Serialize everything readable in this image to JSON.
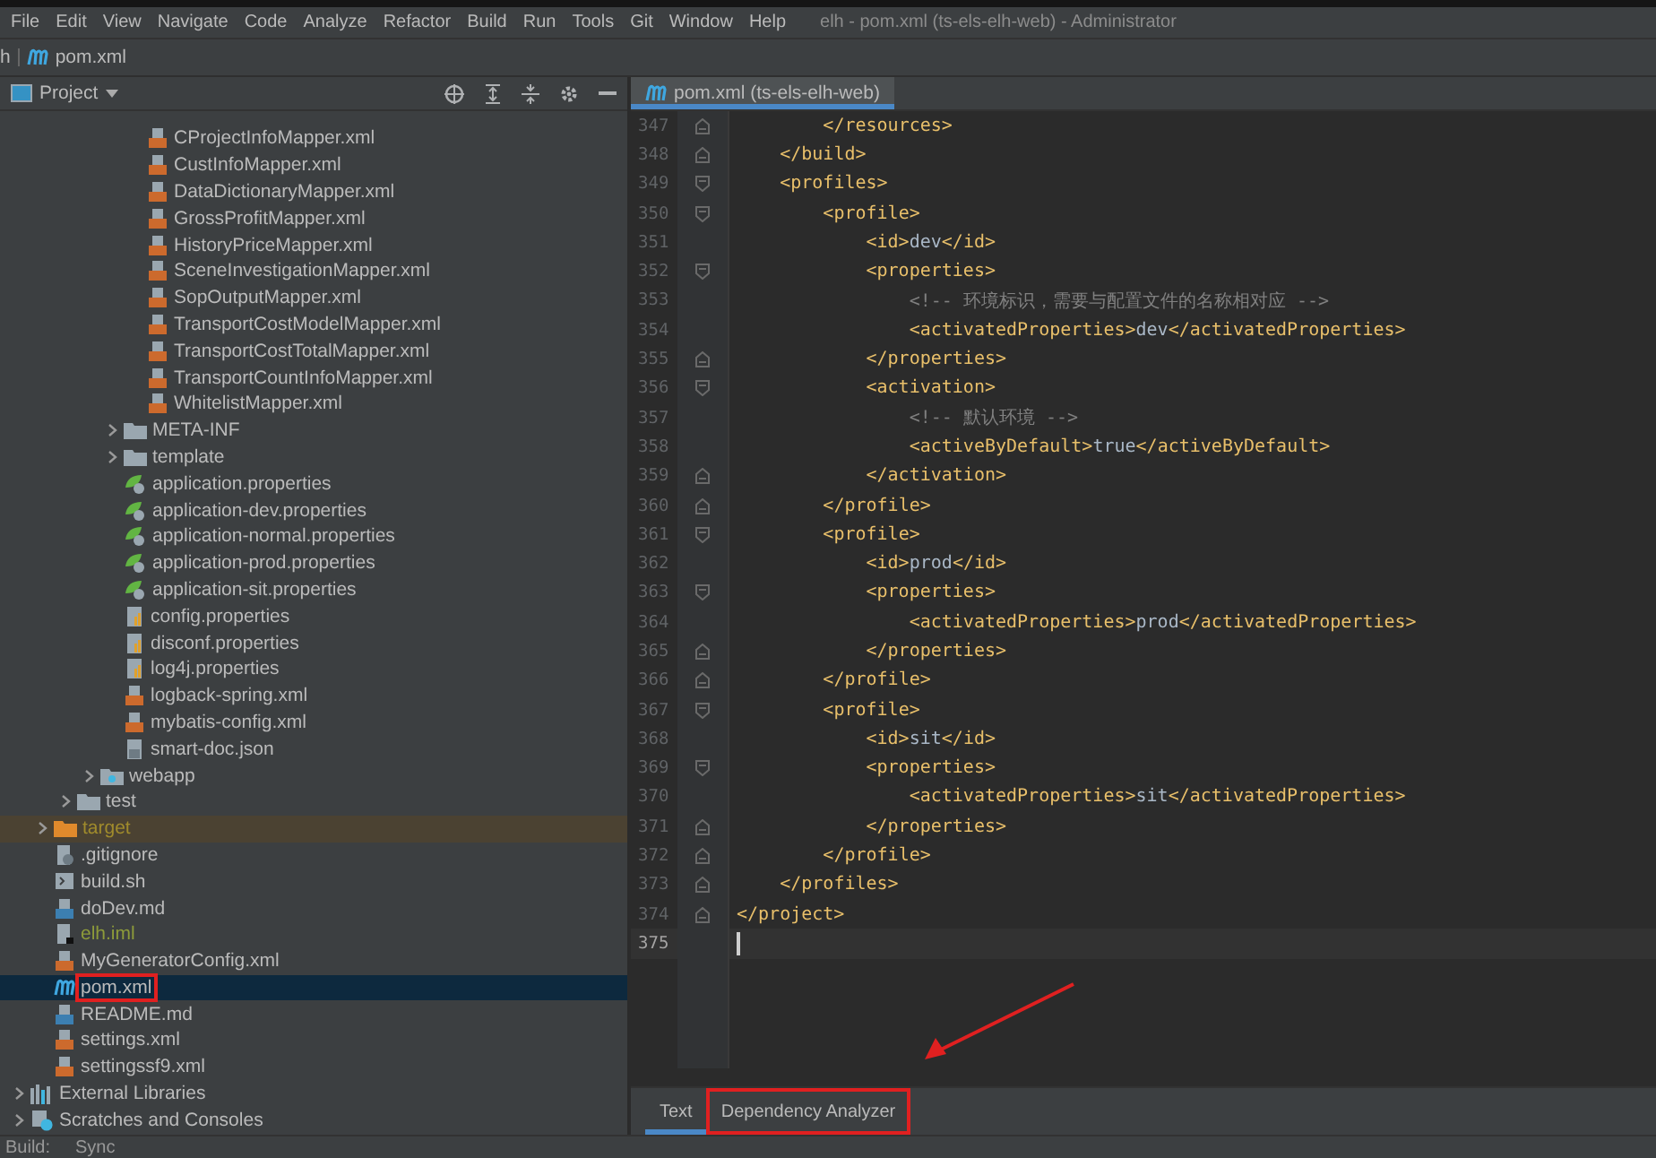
{
  "menu": [
    "File",
    "Edit",
    "View",
    "Navigate",
    "Code",
    "Analyze",
    "Refactor",
    "Build",
    "Run",
    "Tools",
    "Git",
    "Window",
    "Help"
  ],
  "window": {
    "title": "elh - pom.xml (ts-els-elh-web) - Administrator"
  },
  "breadcrumb": {
    "project": "h",
    "file": "pom.xml"
  },
  "project_panel": {
    "title": "Project",
    "tree": [
      {
        "children": [
          {
            "children": [
              {
                "children": [
                  {
                    "children": [
                      {
                        "children": [
                          {
                            "label": "CProjectInfoMapper.xml",
                            "kind": "xml",
                            "selected": false
                          },
                          {
                            "label": "CustInfoMapper.xml",
                            "kind": "xml",
                            "selected": false
                          },
                          {
                            "label": "DataDictionaryMapper.xml",
                            "kind": "xml",
                            "selected": false
                          },
                          {
                            "label": "GrossProfitMapper.xml",
                            "kind": "xml",
                            "selected": false
                          },
                          {
                            "label": "HistoryPriceMapper.xml",
                            "kind": "xml",
                            "selected": false
                          },
                          {
                            "label": "SceneInvestigationMapper.xml",
                            "kind": "xml",
                            "selected": false
                          },
                          {
                            "label": "SopOutputMapper.xml",
                            "kind": "xml",
                            "selected": false
                          },
                          {
                            "label": "TransportCostModelMapper.xml",
                            "kind": "xml",
                            "selected": false
                          },
                          {
                            "label": "TransportCostTotalMapper.xml",
                            "kind": "xml",
                            "selected": false
                          },
                          {
                            "label": "TransportCountInfoMapper.xml",
                            "kind": "xml",
                            "selected": false
                          },
                          {
                            "label": "WhitelistMapper.xml",
                            "kind": "xml",
                            "selected": false
                          }
                        ]
                      },
                      {
                        "label": "META-INF",
                        "kind": "folder",
                        "expanded": false,
                        "selected": false
                      },
                      {
                        "label": "template",
                        "kind": "folder",
                        "expanded": false,
                        "selected": false
                      },
                      {
                        "label": "application.properties",
                        "kind": "spring",
                        "selected": false
                      },
                      {
                        "label": "application-dev.properties",
                        "kind": "spring",
                        "selected": false
                      },
                      {
                        "label": "application-normal.properties",
                        "kind": "spring",
                        "selected": false
                      },
                      {
                        "label": "application-prod.properties",
                        "kind": "spring",
                        "selected": false
                      },
                      {
                        "label": "application-sit.properties",
                        "kind": "spring",
                        "selected": false
                      },
                      {
                        "label": "config.properties",
                        "kind": "properties",
                        "selected": false
                      },
                      {
                        "label": "disconf.properties",
                        "kind": "properties",
                        "selected": false
                      },
                      {
                        "label": "log4j.properties",
                        "kind": "properties",
                        "selected": false
                      },
                      {
                        "label": "logback-spring.xml",
                        "kind": "xml",
                        "selected": false
                      },
                      {
                        "label": "mybatis-config.xml",
                        "kind": "xml",
                        "selected": false
                      },
                      {
                        "label": "smart-doc.json",
                        "kind": "json",
                        "selected": false
                      }
                    ]
                  },
                  {
                    "label": "webapp",
                    "kind": "webfolder",
                    "expanded": false,
                    "selected": false
                  }
                ]
              },
              {
                "label": "test",
                "kind": "folder",
                "expanded": false,
                "selected": false
              }
            ]
          },
          {
            "label": "target",
            "kind": "excluded",
            "expanded": false,
            "selected": false,
            "color": "#a08b2c"
          },
          {
            "label": ".gitignore",
            "kind": "gitignore",
            "selected": false
          },
          {
            "label": "build.sh",
            "kind": "shell",
            "selected": false
          },
          {
            "label": "doDev.md",
            "kind": "markdown",
            "selected": false
          },
          {
            "label": "elh.iml",
            "kind": "iml",
            "selected": false,
            "color": "#8d9b3a"
          },
          {
            "label": "MyGeneratorConfig.xml",
            "kind": "xml",
            "selected": false
          },
          {
            "label": "pom.xml",
            "kind": "maven",
            "selected": true,
            "annotated": true
          },
          {
            "label": "README.md",
            "kind": "markdown",
            "selected": false
          },
          {
            "label": "settings.xml",
            "kind": "xml",
            "selected": false
          },
          {
            "label": "settingssf9.xml",
            "kind": "xml",
            "selected": false
          }
        ]
      },
      {
        "label": "External Libraries",
        "kind": "libraries",
        "expanded": false,
        "selected": false
      },
      {
        "label": "Scratches and Consoles",
        "kind": "scratches",
        "expanded": false,
        "selected": false
      }
    ]
  },
  "editor": {
    "tab": {
      "label": "pom.xml (ts-els-elh-web)",
      "selected": true
    },
    "lines": [
      {
        "number": "347",
        "text": "        </resources>",
        "fold_end": true
      },
      {
        "number": "348",
        "text": "    </build>",
        "fold_end": true
      },
      {
        "number": "349",
        "text": "    <profiles>",
        "fold_start": true
      },
      {
        "number": "350",
        "text": "        <profile>",
        "fold_start": true
      },
      {
        "number": "351",
        "text": "            <id>dev</id>"
      },
      {
        "number": "352",
        "text": "            <properties>",
        "fold_start": true
      },
      {
        "number": "353",
        "text": "                <!-- 环境标识，需要与配置文件的名称相对应 -->"
      },
      {
        "number": "354",
        "text": "                <activatedProperties>dev</activatedProperties>"
      },
      {
        "number": "355",
        "text": "            </properties>",
        "fold_end": true
      },
      {
        "number": "356",
        "text": "            <activation>",
        "fold_start": true
      },
      {
        "number": "357",
        "text": "                <!-- 默认环境 -->"
      },
      {
        "number": "358",
        "text": "                <activeByDefault>true</activeByDefault>"
      },
      {
        "number": "359",
        "text": "            </activation>",
        "fold_end": true
      },
      {
        "number": "360",
        "text": "        </profile>",
        "fold_end": true
      },
      {
        "number": "361",
        "text": "        <profile>",
        "fold_start": true
      },
      {
        "number": "362",
        "text": "            <id>prod</id>"
      },
      {
        "number": "363",
        "text": "            <properties>",
        "fold_start": true
      },
      {
        "number": "364",
        "text": "                <activatedProperties>prod</activatedProperties>"
      },
      {
        "number": "365",
        "text": "            </properties>",
        "fold_end": true
      },
      {
        "number": "366",
        "text": "        </profile>",
        "fold_end": true
      },
      {
        "number": "367",
        "text": "        <profile>",
        "fold_start": true
      },
      {
        "number": "368",
        "text": "            <id>sit</id>"
      },
      {
        "number": "369",
        "text": "            <properties>",
        "fold_start": true
      },
      {
        "number": "370",
        "text": "                <activatedProperties>sit</activatedProperties>"
      },
      {
        "number": "371",
        "text": "            </properties>",
        "fold_end": true
      },
      {
        "number": "372",
        "text": "        </profile>",
        "fold_end": true
      },
      {
        "number": "373",
        "text": "    </profiles>",
        "fold_end": true
      },
      {
        "number": "374",
        "text": "</project>",
        "fold_end": true
      },
      {
        "number": "375",
        "current": true
      }
    ],
    "bottom_tabs": [
      {
        "label": "Text",
        "selected": true,
        "annotated": false
      },
      {
        "label": "Dependency Analyzer",
        "selected": false,
        "annotated": true
      }
    ]
  },
  "status_bar": {
    "label": "Build:",
    "tab": "Sync"
  }
}
